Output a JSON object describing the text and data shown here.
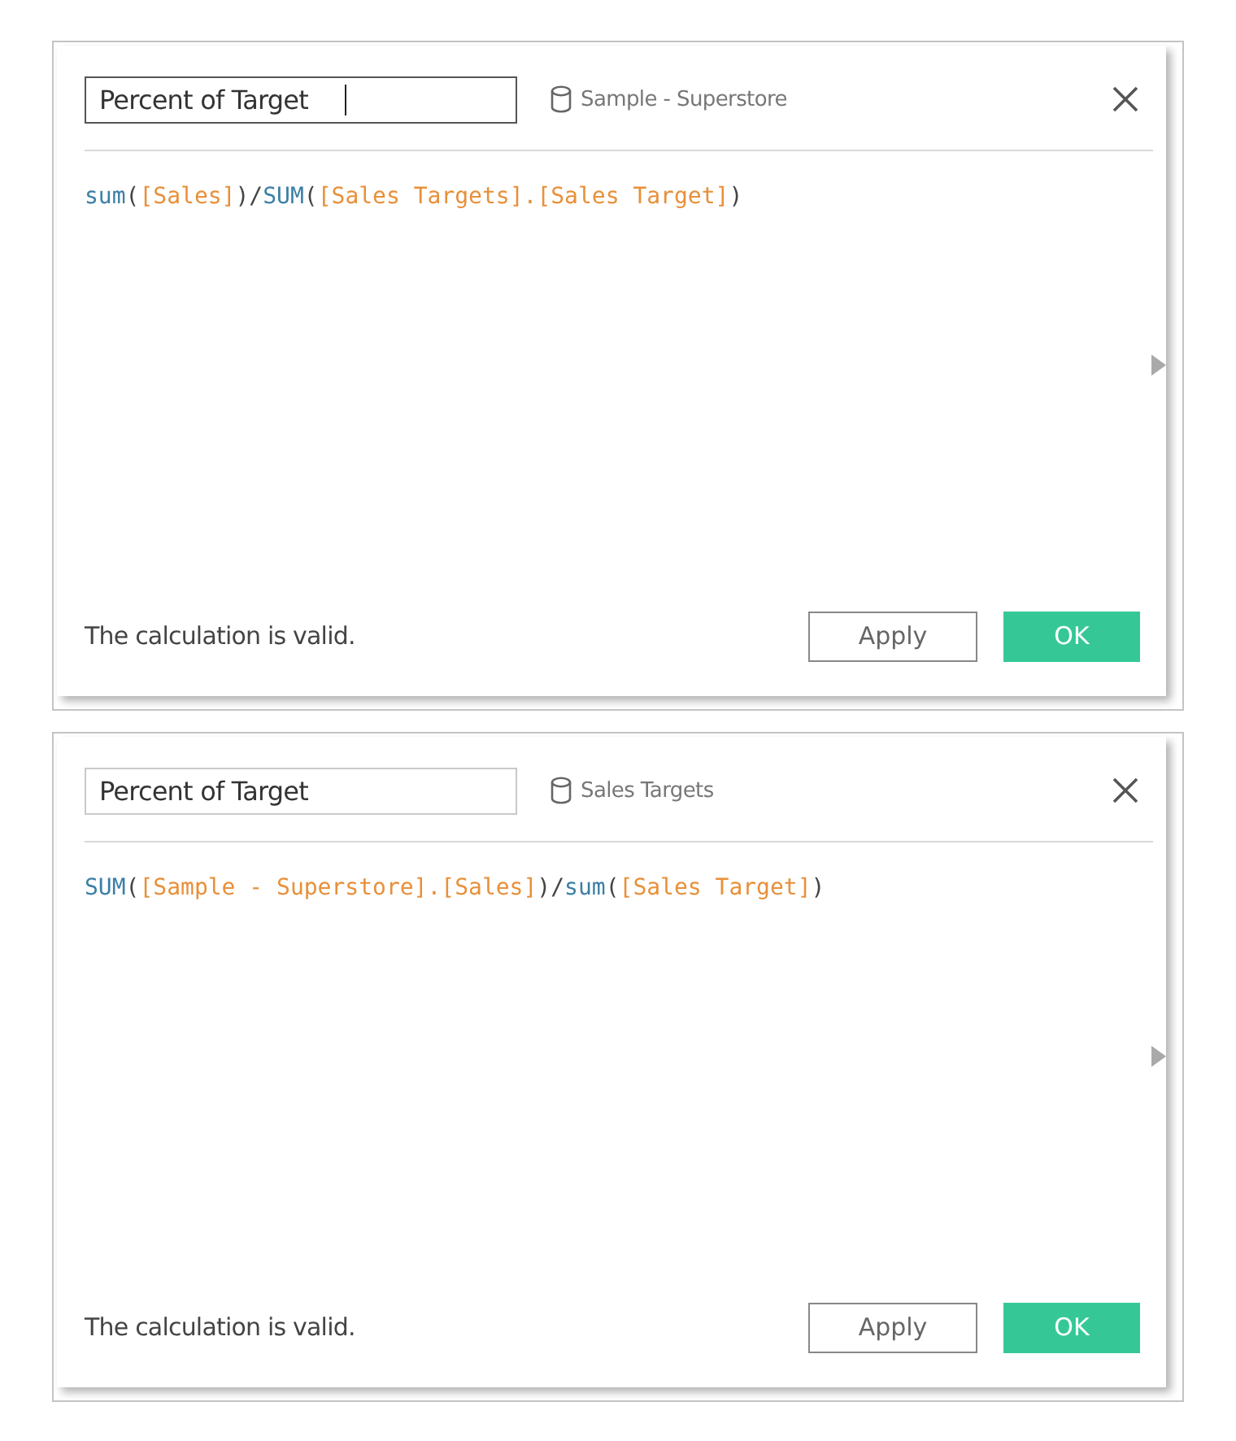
{
  "dialogs": [
    {
      "name_field": {
        "value": "Percent of Target",
        "focused": true
      },
      "data_source": "Sample - Superstore",
      "formula": [
        {
          "kind": "function",
          "text": "sum"
        },
        {
          "kind": "punct",
          "text": "("
        },
        {
          "kind": "field",
          "text": "[Sales]"
        },
        {
          "kind": "punct",
          "text": ")/"
        },
        {
          "kind": "function",
          "text": "SUM"
        },
        {
          "kind": "punct",
          "text": "("
        },
        {
          "kind": "field",
          "text": "[Sales Targets].[Sales Target]"
        },
        {
          "kind": "punct",
          "text": ")"
        }
      ],
      "status": "The calculation is valid.",
      "buttons": [
        {
          "label": "Apply",
          "kind": "secondary"
        },
        {
          "label": "OK",
          "kind": "primary"
        }
      ]
    },
    {
      "name_field": {
        "value": "Percent of Target",
        "focused": false
      },
      "data_source": "Sales Targets",
      "formula": [
        {
          "kind": "function",
          "text": "SUM"
        },
        {
          "kind": "punct",
          "text": "("
        },
        {
          "kind": "field",
          "text": "[Sample - Superstore].[Sales]"
        },
        {
          "kind": "punct",
          "text": ")/"
        },
        {
          "kind": "function",
          "text": "sum"
        },
        {
          "kind": "punct",
          "text": "("
        },
        {
          "kind": "field",
          "text": "[Sales Target]"
        },
        {
          "kind": "punct",
          "text": ")"
        }
      ],
      "status": "The calculation is valid.",
      "buttons": [
        {
          "label": "Apply",
          "kind": "secondary"
        },
        {
          "label": "OK",
          "kind": "primary"
        }
      ]
    }
  ]
}
